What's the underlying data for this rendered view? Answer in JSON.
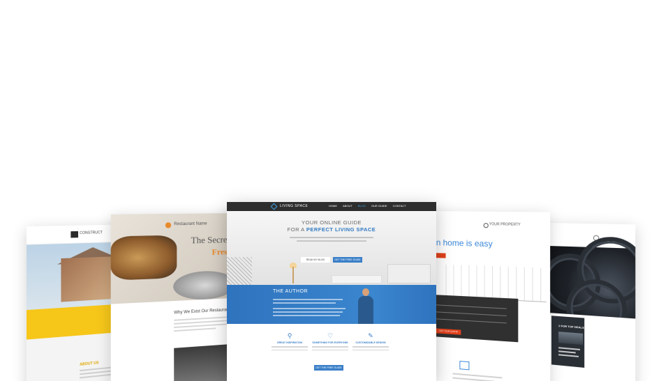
{
  "far_left": {
    "logo_text": "CONSTRUCT",
    "about_label": "ABOUT US"
  },
  "left": {
    "logo_text": "Restaurant Name",
    "secret": "The Secret to",
    "fresh": "Fresh",
    "why": "Why We Exist Our Restaurant"
  },
  "center": {
    "logo_text": "LIVING SPACE",
    "nav": [
      "HOME",
      "ABOUT",
      "BLOG",
      "OUR GUIDE",
      "CONTACT"
    ],
    "active_nav": "BLOG",
    "hero_line1": "YOUR ONLINE GUIDE",
    "hero_line2_prefix": "FOR A",
    "hero_line2_bold": "PERFECT LIVING SPACE",
    "btn_read": "READ MY BLOG",
    "btn_guide": "GET THE FREE GUIDE",
    "author_title": "THE AUTHOR",
    "features": [
      {
        "icon": "lightbulb-icon",
        "glyph": "⚲",
        "title": "GREAT INSPIRATION"
      },
      {
        "icon": "heart-icon",
        "glyph": "♡",
        "title": "SOMETHING FOR EVERYONE"
      },
      {
        "icon": "pencil-icon",
        "glyph": "✎",
        "title": "CUSTOMIZABLE DESIGN"
      }
    ],
    "cta": "GET THE FREE GUIDE"
  },
  "right": {
    "logo_text": "YOUR PROPERTY",
    "headline": "n home is easy",
    "form_button": "GET YOUR QUOTE"
  },
  "far_right": {
    "box_title": "2 FOR TOP DEALS"
  }
}
